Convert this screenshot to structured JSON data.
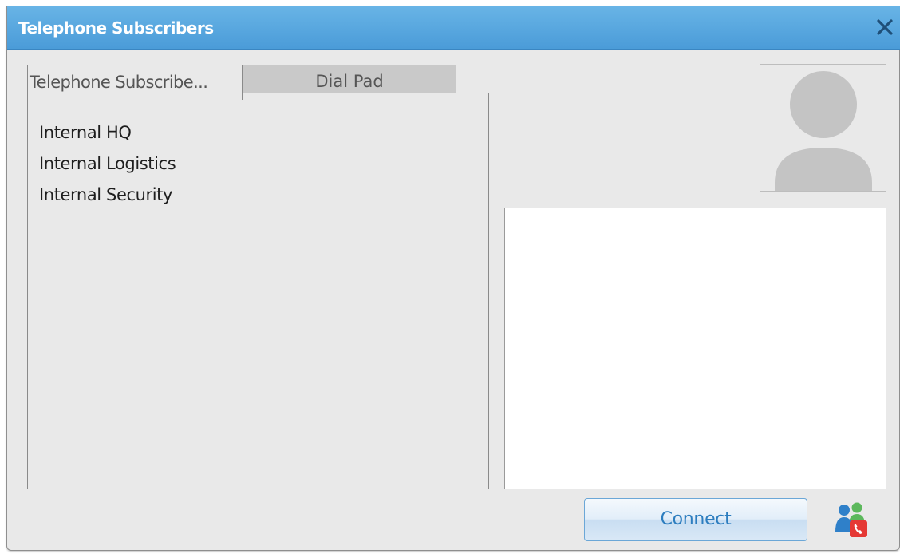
{
  "window": {
    "title": "Telephone Subscribers"
  },
  "tabs": [
    {
      "label": "Telephone Subscribe...",
      "active": true
    },
    {
      "label": "Dial Pad",
      "active": false
    }
  ],
  "subscribers": [
    {
      "label": "Internal HQ"
    },
    {
      "label": "Internal Logistics"
    },
    {
      "label": "Internal Security"
    }
  ],
  "actions": {
    "connect_label": "Connect"
  },
  "icons": {
    "close": "close-icon",
    "avatar": "user-avatar-placeholder-icon",
    "contacts_call": "contacts-call-icon"
  },
  "colors": {
    "titlebar": "#4a9bd8",
    "window_bg": "#e9e9e9",
    "inactive_tab": "#c9c9c9",
    "button_text": "#2c7dbf",
    "avatar_gray": "#c4c4c4"
  }
}
